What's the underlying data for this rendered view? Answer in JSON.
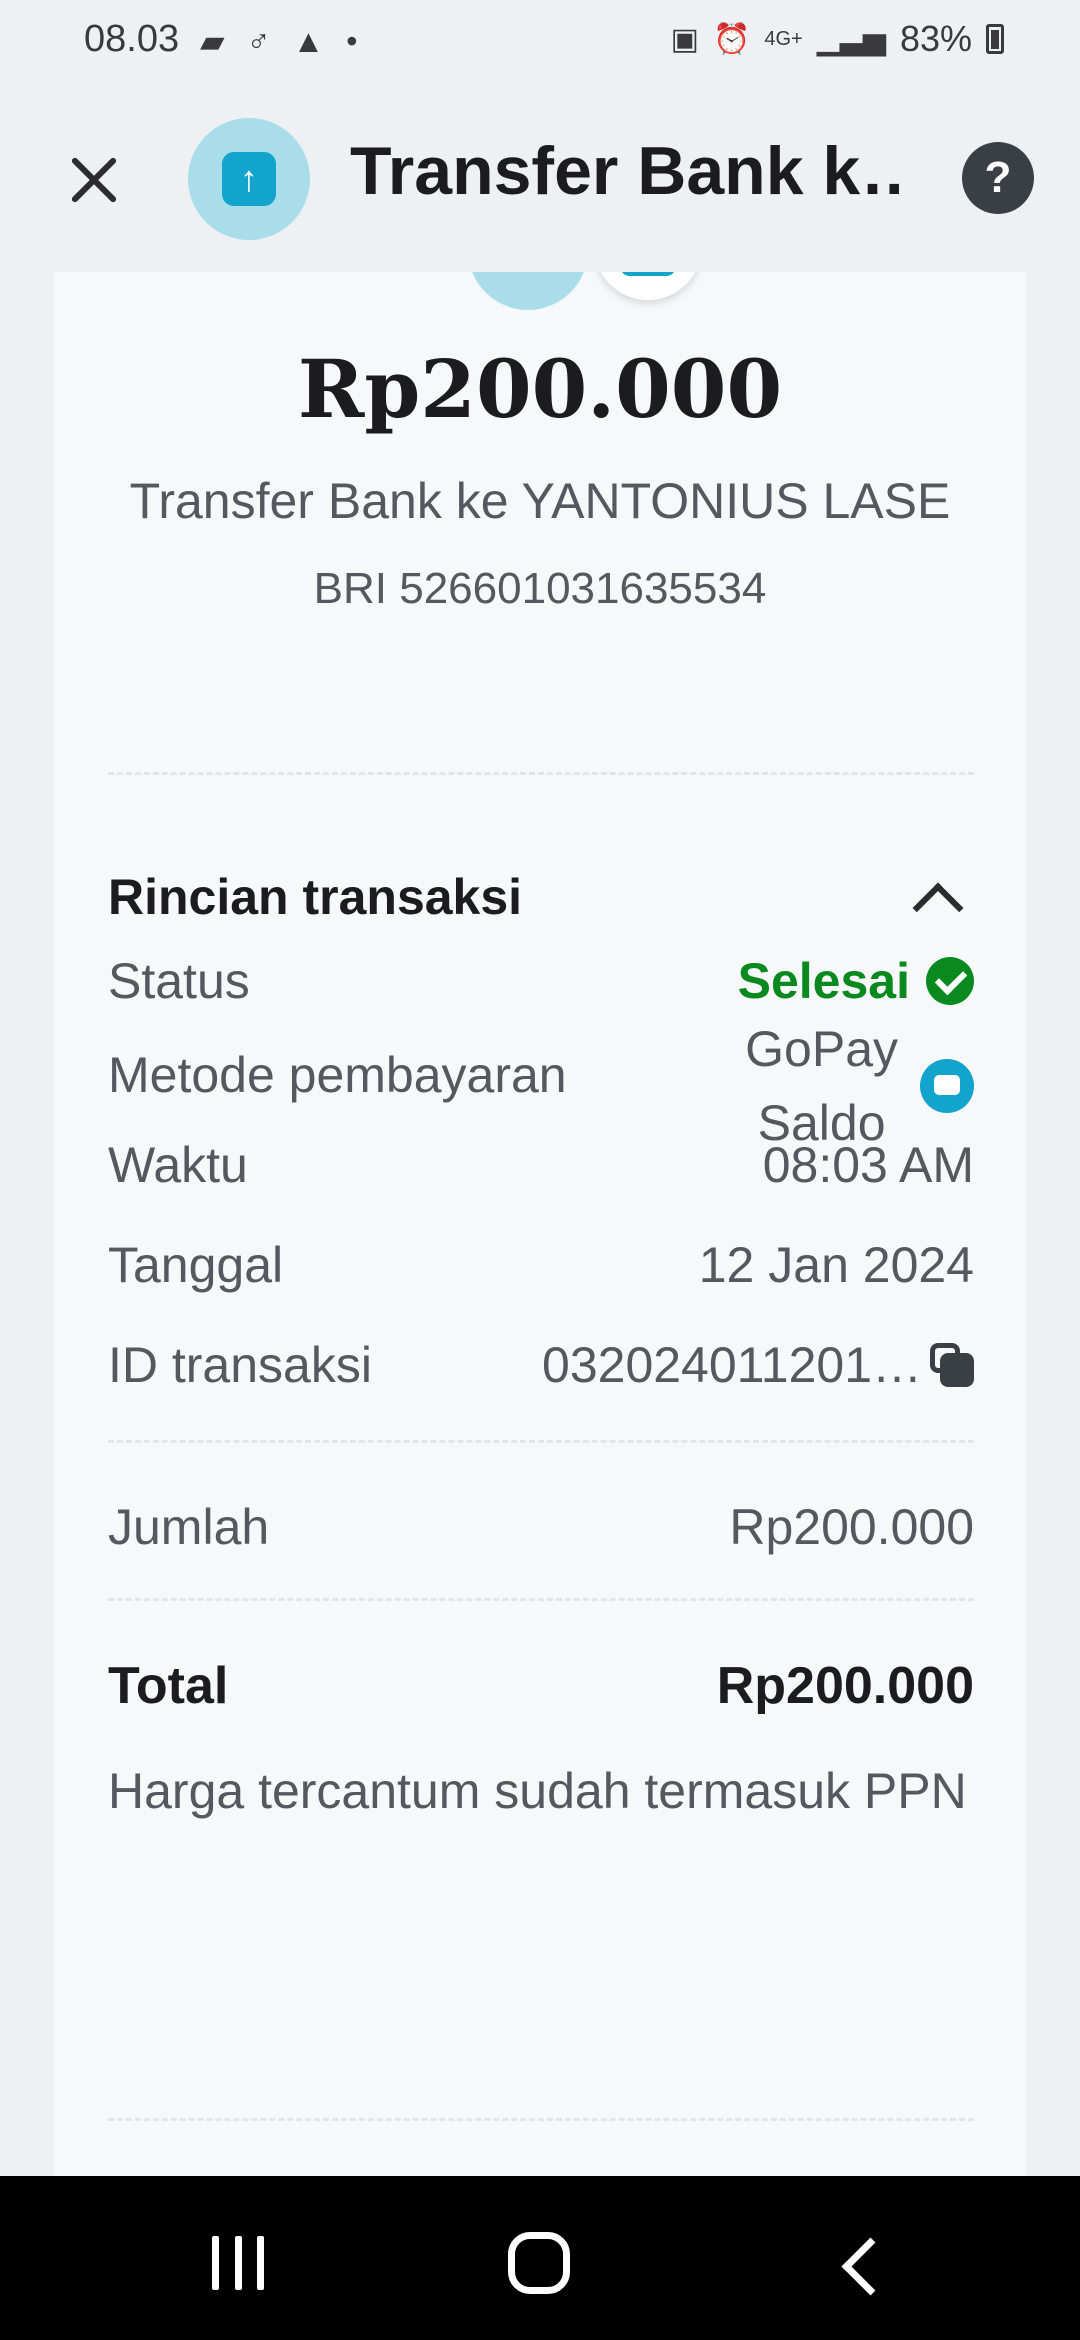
{
  "status_bar": {
    "time": "08.03",
    "battery": "83%",
    "network": "4G+"
  },
  "header": {
    "title": "Transfer Bank k…",
    "icon": "arrow-up-icon"
  },
  "summary": {
    "amount": "Rp200.000",
    "recipient": "Transfer Bank ke YANTONIUS LASE",
    "account": "BRI 526601031635534"
  },
  "details": {
    "section_title": "Rincian transaksi",
    "status_label": "Status",
    "status_value": "Selesai",
    "payment_label": "Metode pembayaran",
    "payment_value_line1": "GoPay",
    "payment_value_line2": "Saldo",
    "time_label": "Waktu",
    "time_value": "08:03 AM",
    "date_label": "Tanggal",
    "date_value": "12 Jan 2024",
    "id_label": "ID transaksi",
    "id_value": "032024011201…",
    "amount_label": "Jumlah",
    "amount_value": "Rp200.000",
    "total_label": "Total",
    "total_value": "Rp200.000",
    "tax_note": "Harga tercantum sudah termasuk PPN"
  },
  "colors": {
    "accent": "#12a4cc",
    "success": "#0a8a1e",
    "background": "#eef0f3"
  }
}
